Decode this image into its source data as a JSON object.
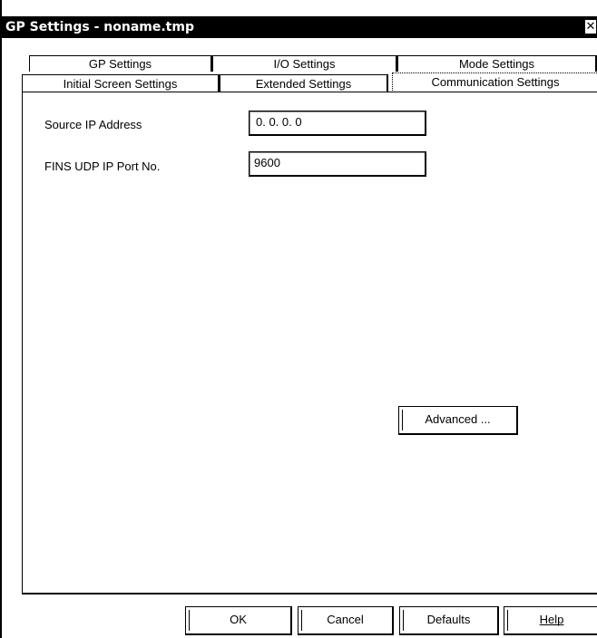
{
  "window": {
    "title": "GP Settings - noname.tmp",
    "close_glyph": "✕"
  },
  "tabs": {
    "back_row": [
      "GP Settings",
      "I/O Settings",
      "Mode Settings"
    ],
    "front_row": [
      "Initial Screen Settings",
      "Extended Settings",
      "Communication Settings"
    ],
    "active": "Communication Settings"
  },
  "form": {
    "source_ip_label": "Source IP Address",
    "source_ip_value": "0.  0.  0.  0",
    "fins_port_label": "FINS UDP IP Port No.",
    "fins_port_value": "9600"
  },
  "buttons": {
    "advanced": "Advanced ...",
    "ok": "OK",
    "cancel": "Cancel",
    "defaults": "Defaults",
    "help": "Help"
  }
}
